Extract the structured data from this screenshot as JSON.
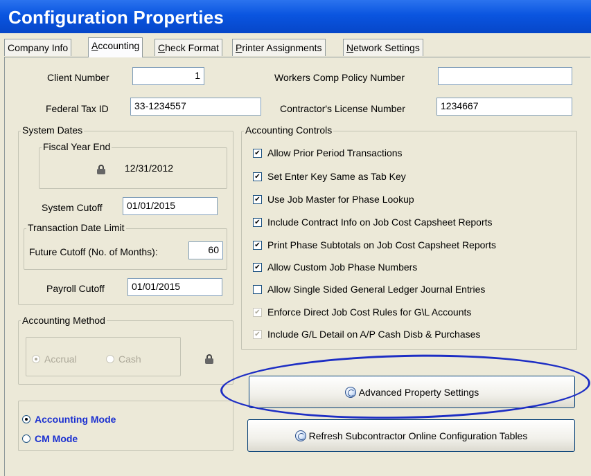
{
  "window": {
    "title": "Configuration Properties"
  },
  "tabs": [
    {
      "label": "Company Info",
      "mnemonic": "",
      "rest": "Company Info"
    },
    {
      "label": "Accounting",
      "mnemonic": "A",
      "rest": "ccounting"
    },
    {
      "label": "Check Format",
      "mnemonic": "C",
      "rest": "heck Format"
    },
    {
      "label": "Printer Assignments",
      "mnemonic": "P",
      "rest": "rinter Assignments"
    },
    {
      "label": "Network Settings",
      "mnemonic": "N",
      "rest": "etwork Settings"
    }
  ],
  "fields": {
    "client_number": {
      "label": "Client Number",
      "value": "1"
    },
    "federal_tax_id": {
      "label": "Federal Tax ID",
      "value": "33-1234557"
    },
    "workers_comp": {
      "label": "Workers Comp Policy Number",
      "value": ""
    },
    "contractor_license": {
      "label": "Contractor's License Number",
      "value": "1234667"
    }
  },
  "system_dates": {
    "title": "System Dates",
    "fiscal_year_end": {
      "title": "Fiscal Year End",
      "value": "12/31/2012"
    },
    "system_cutoff": {
      "label": "System Cutoff",
      "value": "01/01/2015"
    },
    "transaction_limit": {
      "title": "Transaction Date Limit",
      "future_label": "Future Cutoff (No. of Months):",
      "future_value": "60"
    },
    "payroll_cutoff": {
      "label": "Payroll Cutoff",
      "value": "01/01/2015"
    }
  },
  "accounting_method": {
    "title": "Accounting Method",
    "options": [
      {
        "label": "Accrual",
        "selected": true
      },
      {
        "label": "Cash",
        "selected": false
      }
    ]
  },
  "accounting_controls": {
    "title": "Accounting Controls",
    "items": [
      {
        "label": "Allow Prior Period Transactions",
        "checked": true,
        "enabled": true
      },
      {
        "label": "Set Enter Key Same as Tab Key",
        "checked": true,
        "enabled": true
      },
      {
        "label": "Use Job Master for Phase Lookup",
        "checked": true,
        "enabled": true
      },
      {
        "label": "Include Contract Info on Job Cost Capsheet Reports",
        "checked": true,
        "enabled": true
      },
      {
        "label": "Print Phase Subtotals on Job Cost Capsheet Reports",
        "checked": true,
        "enabled": true
      },
      {
        "label": "Allow Custom Job Phase Numbers",
        "checked": true,
        "enabled": true
      },
      {
        "label": "Allow Single Sided General Ledger Journal Entries",
        "checked": false,
        "enabled": true
      },
      {
        "label": "Enforce Direct Job Cost Rules for G\\L Accounts",
        "checked": true,
        "enabled": false
      },
      {
        "label": "Include G/L Detail on A/P Cash Disb & Purchases",
        "checked": true,
        "enabled": false
      }
    ]
  },
  "modes": [
    {
      "label": "Accounting Mode",
      "selected": true
    },
    {
      "label": "CM Mode",
      "selected": false
    }
  ],
  "buttons": {
    "advanced": "Advanced Property Settings",
    "refresh": "Refresh Subcontractor Online Configuration Tables"
  },
  "colors": {
    "titlebar": "#0a55e0",
    "mode_text": "#1a2fd0",
    "annotation": "#1d2ec4"
  }
}
